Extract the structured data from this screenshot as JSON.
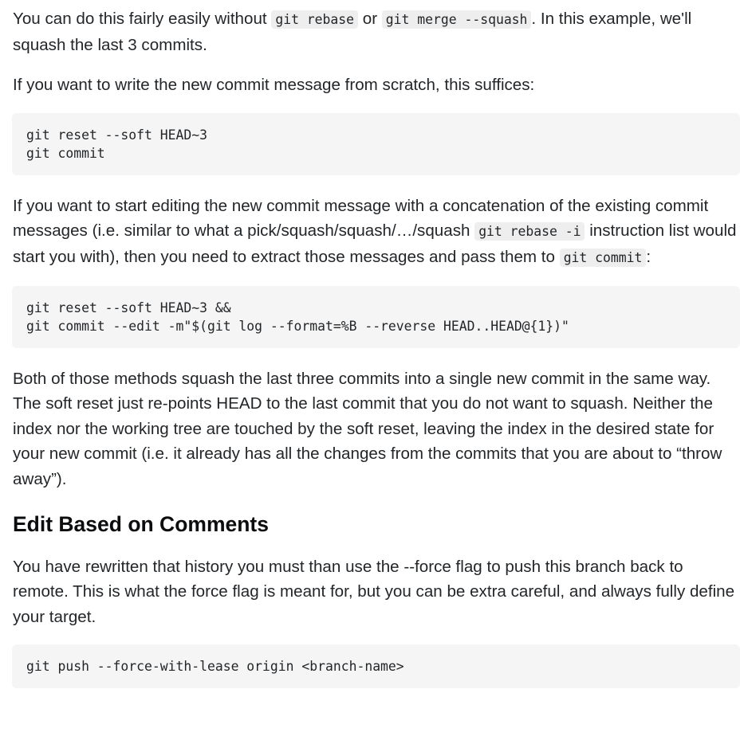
{
  "intro": {
    "t1": "You can do this fairly easily without ",
    "c1": "git rebase",
    "t2": " or ",
    "c2": "git merge --squash",
    "t3": ". In this example, we'll squash the last 3 commits."
  },
  "scratch_text": "If you want to write the new commit message from scratch, this suffices:",
  "code_block_1": {
    "line1": "git reset --soft HEAD~3",
    "line2": "git commit"
  },
  "edit_para": {
    "t1": "If you want to start editing the new commit message with a concatenation of the existing commit messages (i.e. similar to what a pick/squash/squash/…/squash ",
    "c1": "git rebase -i",
    "t2": " instruction list would start you with), then you need to extract those messages and pass them to ",
    "c2": "git commit",
    "t3": ":"
  },
  "code_block_2": {
    "line1": "git reset --soft HEAD~3 &&",
    "line2": "git commit --edit -m\"$(git log --format=%B --reverse HEAD..HEAD@{1})\""
  },
  "both_text": "Both of those methods squash the last three commits into a single new commit in the same way. The soft reset just re-points HEAD to the last commit that you do not want to squash. Neither the index nor the working tree are touched by the soft reset, leaving the index in the desired state for your new commit (i.e. it already has all the changes from the commits that you are about to “throw away”).",
  "heading": "Edit Based on Comments",
  "force_text": "You have rewritten that history you must than use the --force flag to push this branch back to remote. This is what the force flag is meant for, but you can be extra careful, and always fully define your target.",
  "code_block_3": {
    "line1": "git push --force-with-lease origin <branch-name>"
  }
}
